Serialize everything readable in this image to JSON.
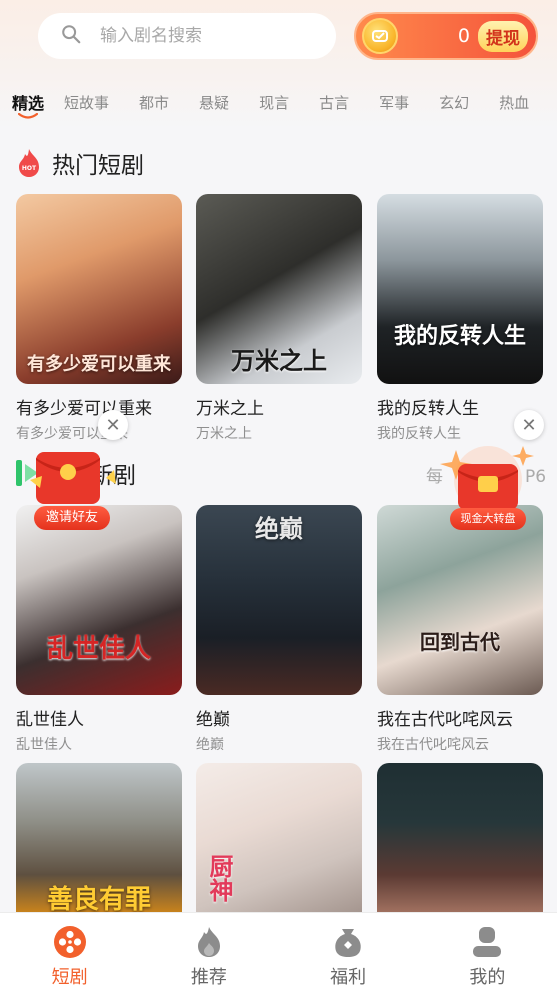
{
  "search": {
    "placeholder": "输入剧名搜索"
  },
  "wallet": {
    "amount": "0",
    "withdraw_label": "提现"
  },
  "tabs": [
    "精选",
    "短故事",
    "都市",
    "悬疑",
    "现言",
    "古言",
    "军事",
    "玄幻",
    "热血"
  ],
  "sections": {
    "hot": {
      "title": "热门短剧",
      "items": [
        {
          "title": "有多少爱可以重来",
          "subtitle": "有多少爱可以重来",
          "poster_text": "有多少爱可以重来"
        },
        {
          "title": "万米之上",
          "subtitle": "万米之上",
          "poster_text": "万米之上"
        },
        {
          "title": "我的反转人生",
          "subtitle": "我的反转人生",
          "poster_text": "我的反转人生"
        }
      ]
    },
    "new": {
      "title": "新剧",
      "daily_prefix": "每",
      "daily_suffix": "P6",
      "items": [
        {
          "title": "乱世佳人",
          "subtitle": "乱世佳人",
          "poster_text": "乱世佳人"
        },
        {
          "title": "绝巅",
          "subtitle": "绝巅",
          "poster_text": "绝巅"
        },
        {
          "title": "我在古代叱咤风云",
          "subtitle": "我在古代叱咤风云",
          "poster_text": "回到古代"
        }
      ]
    },
    "more": {
      "items": [
        {
          "poster_text": "善良有罪"
        },
        {
          "poster_text": "厨神"
        },
        {
          "poster_text": ""
        }
      ]
    }
  },
  "floats": {
    "invite_label": "邀请好友",
    "wheel_label": "现金大转盘",
    "close_symbol": "✕"
  },
  "bottom_nav": [
    {
      "label": "短剧",
      "icon": "film-reel-icon",
      "active": true
    },
    {
      "label": "推荐",
      "icon": "flame-icon",
      "active": false
    },
    {
      "label": "福利",
      "icon": "gift-bag-icon",
      "active": false
    },
    {
      "label": "我的",
      "icon": "user-icon",
      "active": false
    }
  ],
  "colors": {
    "accent": "#f2602c",
    "wallet_start": "#ff8a4c",
    "wallet_end": "#f4533b"
  }
}
